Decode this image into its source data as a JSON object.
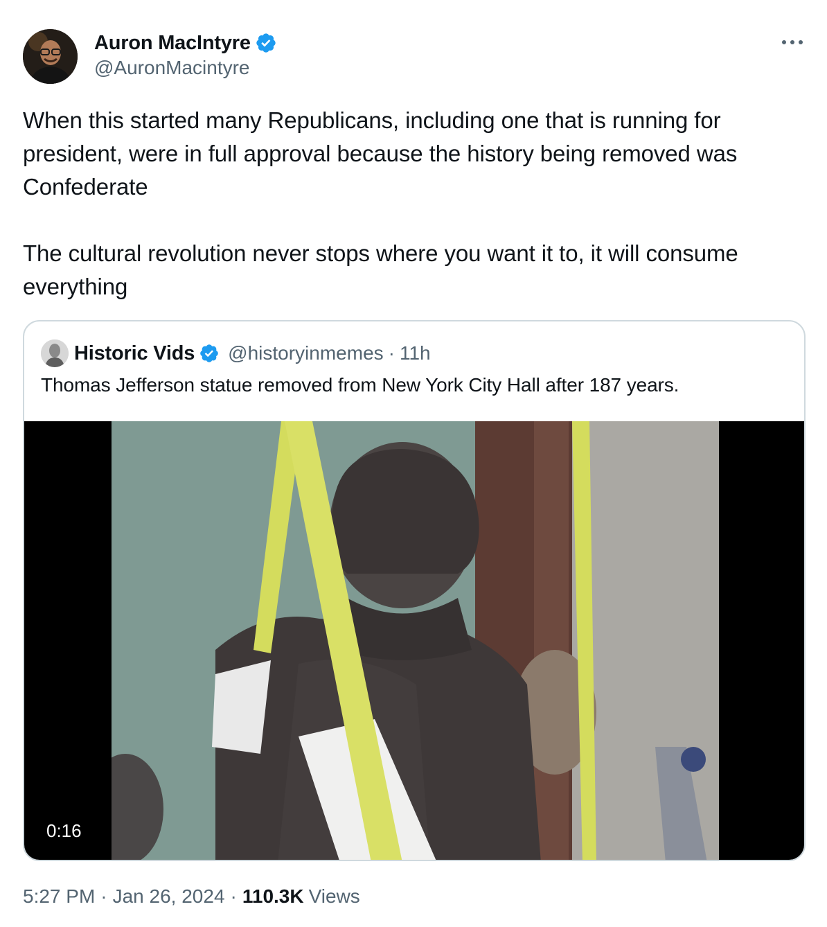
{
  "author": {
    "display_name": "Auron MacIntyre",
    "handle": "@AuronMacintyre",
    "verified": true,
    "avatar_icon": "profile-photo-man-glasses"
  },
  "tweet": {
    "text": "When this started many Republicans, including one that is running for president, were in full approval because the history being removed was Confederate\n\nThe cultural revolution never stops where you want it to, it will consume everything"
  },
  "quoted": {
    "display_name": "Historic Vids",
    "handle": "@historyinmemes",
    "separator": "·",
    "time": "11h",
    "verified": true,
    "avatar_icon": "bust-portrait-icon",
    "text": "Thomas Jefferson statue removed from New York City Hall after 187 years.",
    "media": {
      "type": "video",
      "duration": "0:16",
      "description_icon": "statue-video-thumbnail"
    }
  },
  "footer": {
    "time": "5:27 PM",
    "separator": "·",
    "date": "Jan 26, 2024",
    "separator2": "·",
    "views_count": "110.3K",
    "views_label": "Views"
  },
  "colors": {
    "text": "#0f1419",
    "secondary": "#536471",
    "verified_blue": "#1d9bf0",
    "border": "#cfd9de"
  }
}
